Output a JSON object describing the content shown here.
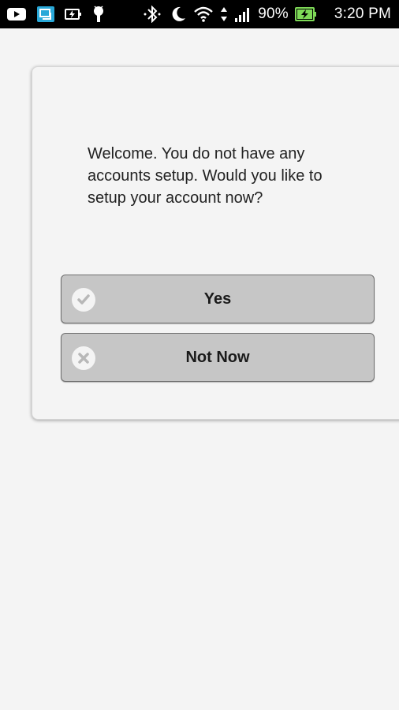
{
  "status_bar": {
    "icons_left": [
      "youtube-icon",
      "screen-share-icon",
      "battery-charging-icon",
      "android-debug-icon"
    ],
    "icons_right": [
      "bluetooth-icon",
      "moon-icon",
      "wifi-icon",
      "data-arrows-icon",
      "signal-icon",
      "battery-icon"
    ],
    "battery_percent": "90%",
    "time": "3:20 PM"
  },
  "dialog": {
    "message": "Welcome. You do not have any accounts setup. Would you like to setup your account now?",
    "buttons": [
      {
        "label": "Yes",
        "icon": "check-icon"
      },
      {
        "label": "Not Now",
        "icon": "close-icon"
      }
    ]
  },
  "colors": {
    "background": "#f4f4f4",
    "button_fill": "#c6c6c6",
    "status_bar": "#000000",
    "battery_accent": "#7ed957"
  }
}
